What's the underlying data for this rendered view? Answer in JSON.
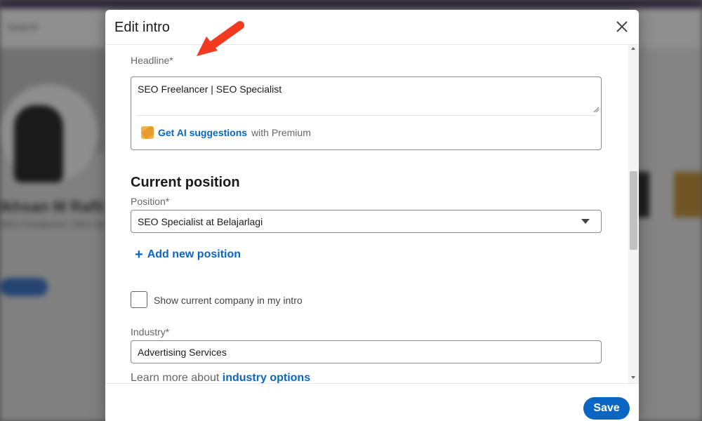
{
  "background": {
    "search_placeholder": "Search",
    "profile_name": "Ikhsan M Rafli",
    "profile_sub": "SEO Freelancer | SEO Sp"
  },
  "modal": {
    "title": "Edit intro",
    "headline": {
      "label": "Headline*",
      "value": "SEO Freelancer | SEO Specialist",
      "ai_link": "Get AI suggestions",
      "ai_suffix": "with Premium"
    },
    "current_position": {
      "title": "Current position",
      "position_label": "Position*",
      "position_value": "SEO Specialist at Belajarlagi",
      "add_position": "Add new position"
    },
    "show_company": {
      "label": "Show current company in my intro",
      "checked": false
    },
    "industry": {
      "label": "Industry*",
      "value": "Advertising Services",
      "learn_prefix": "Learn more about",
      "learn_link": "industry options"
    },
    "footer": {
      "save_label": "Save"
    }
  },
  "colors": {
    "accent": "#0a66c2",
    "annotation_arrow": "#f23a21"
  },
  "icons": {
    "close": "close-icon",
    "premium": "premium-icon",
    "dropdown": "chevron-down-icon",
    "add": "plus-icon"
  }
}
